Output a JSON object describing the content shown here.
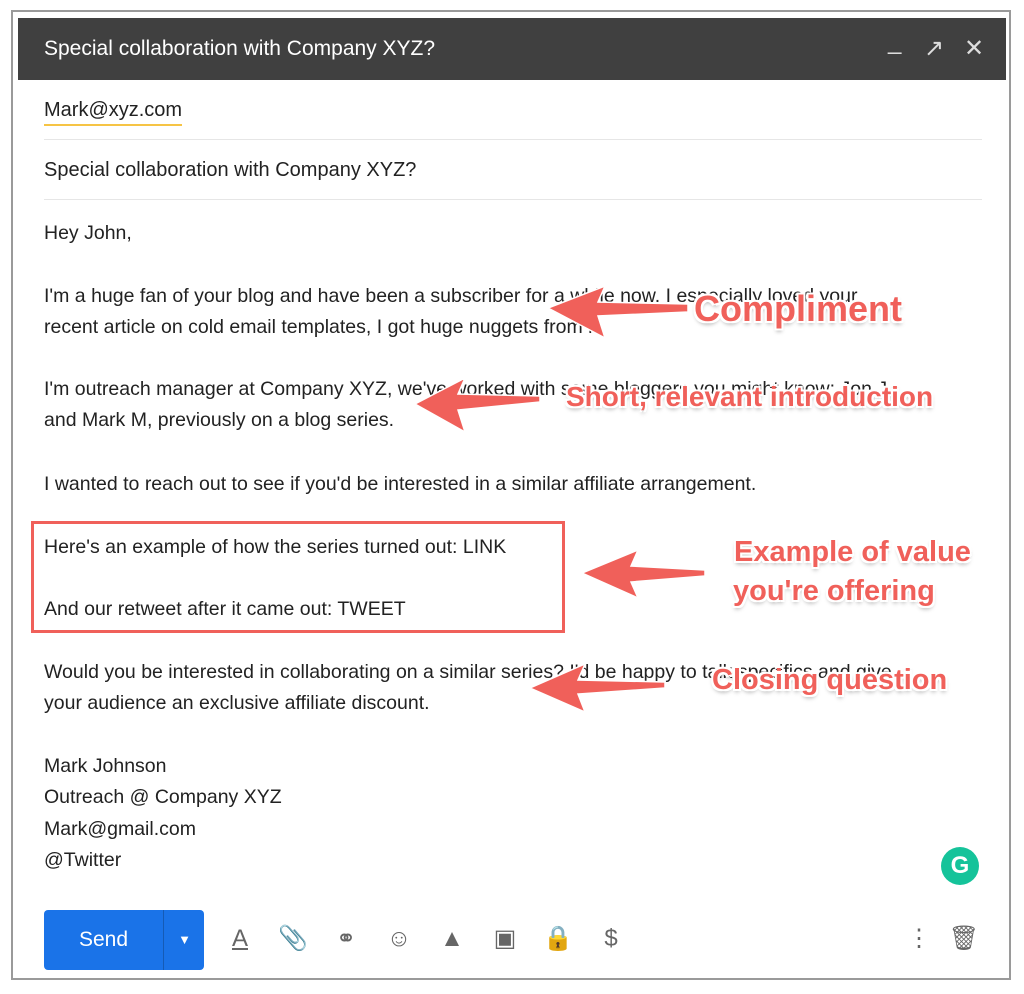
{
  "window": {
    "title": "Special collaboration with Company XYZ?",
    "minimize_icon": "minimize-icon",
    "expand_icon": "expand-icon",
    "close_icon": "close-icon"
  },
  "compose": {
    "to": "Mark@xyz.com",
    "subject": "Special collaboration with Company XYZ?",
    "body_lines": [
      "Hey John,",
      "I'm a huge fan of your blog and have been a subscriber for a while now. I especially loved your",
      "recent article on cold email templates, I got huge nuggets from it.",
      "I'm outreach manager at Company XYZ, we've worked with some bloggers you might know: Jon J.",
      "and Mark M, previously on a blog series.",
      "I wanted to reach out to see if you'd be interested in a similar affiliate arrangement.",
      "Here's an example of how the series turned out: LINK",
      "And our retweet after it came out: TWEET",
      "Would you be interested in collaborating on a similar series? I'd be happy to talk specifics and give",
      "your audience an exclusive affiliate discount.",
      "Mark Johnson",
      "Outreach @ Company XYZ",
      "Mark@gmail.com",
      "@Twitter"
    ]
  },
  "annotations": {
    "color": "#f0605a",
    "compliment": "Compliment",
    "introduction": "Short, relevant introduction",
    "value_line1": "Example of value",
    "value_line2": "you're offering",
    "closing": "Closing question"
  },
  "toolbar": {
    "send_label": "Send",
    "send_color": "#1a73e8",
    "icons": [
      "format-text-icon",
      "attach-icon",
      "link-icon",
      "emoji-icon",
      "drive-icon",
      "photo-icon",
      "confidential-mode-icon",
      "money-icon",
      "more-options-icon",
      "trash-icon"
    ]
  },
  "grammarly": {
    "label": "G",
    "color": "#15c39a"
  }
}
